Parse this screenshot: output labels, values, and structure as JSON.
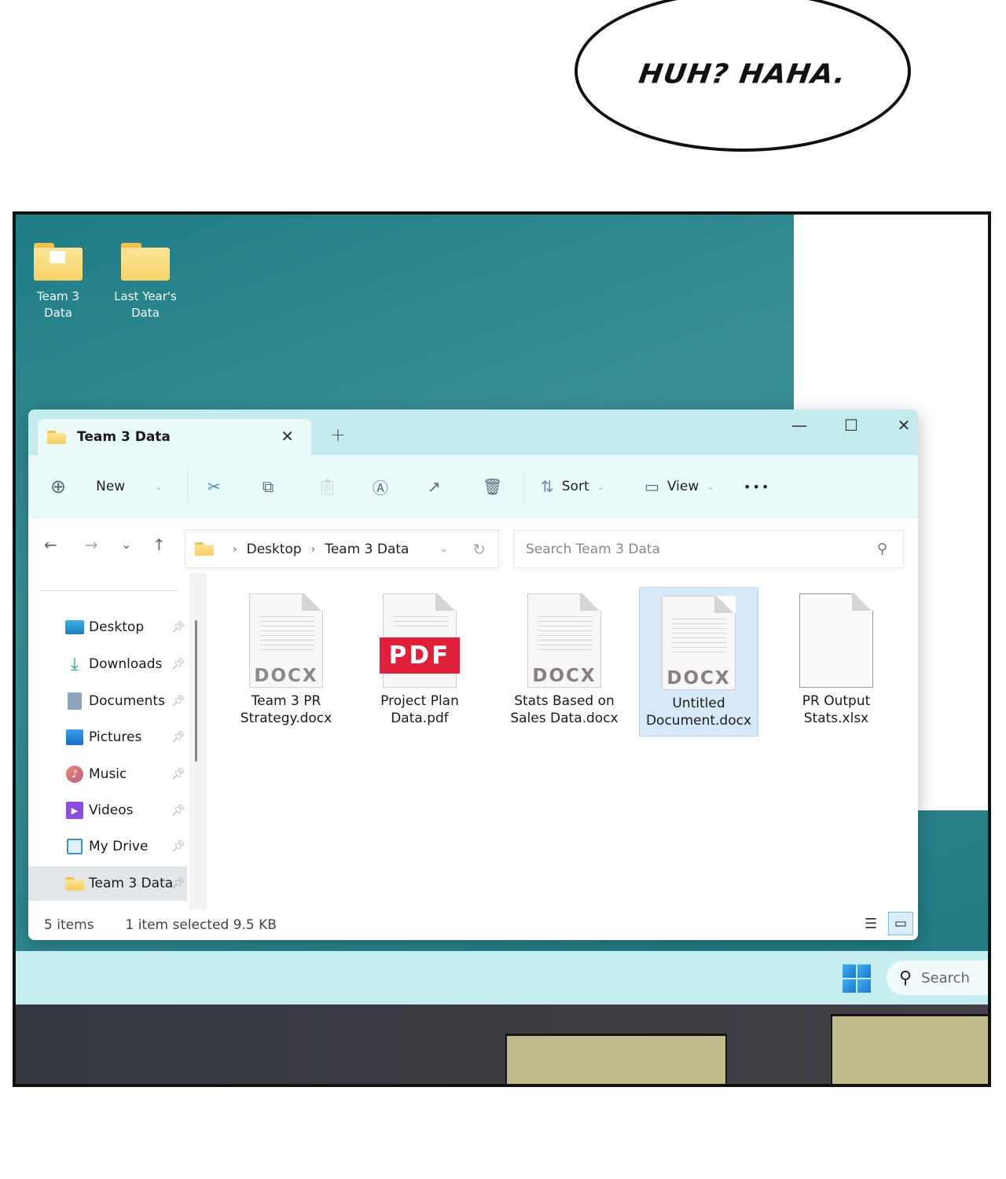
{
  "speech_bubble": {
    "text": "HUH? HAHA."
  },
  "desktop": {
    "icons": [
      {
        "label_line1": "Team 3",
        "label_line2": "Data",
        "icon": "folder-with-file-icon"
      },
      {
        "label_line1": "Last Year's",
        "label_line2": "Data",
        "icon": "folder-icon"
      }
    ]
  },
  "explorer": {
    "tab": {
      "title": "Team 3 Data",
      "close": "✕",
      "add": "+"
    },
    "window_controls": {
      "minimize": "—",
      "maximize": "☐",
      "close": "✕"
    },
    "toolbar": {
      "new_label": "New",
      "sort_label": "Sort",
      "view_label": "View",
      "more": "•••",
      "icons": [
        "add-circle-icon",
        "cut-icon",
        "copy-icon",
        "paste-icon",
        "rename-icon",
        "share-icon",
        "delete-icon",
        "sort-icon",
        "view-icon"
      ]
    },
    "nav": {
      "back": "←",
      "forward": "→",
      "recent": "⌄",
      "up": "↑",
      "breadcrumb": [
        "Desktop",
        "Team 3 Data"
      ],
      "search_placeholder": "Search Team 3 Data"
    },
    "sidebar": {
      "items": [
        {
          "label": "Desktop",
          "icon": "desktop-icon",
          "pinned": true,
          "selected": false
        },
        {
          "label": "Downloads",
          "icon": "download-icon",
          "pinned": true,
          "selected": false
        },
        {
          "label": "Documents",
          "icon": "documents-icon",
          "pinned": true,
          "selected": false
        },
        {
          "label": "Pictures",
          "icon": "pictures-icon",
          "pinned": true,
          "selected": false
        },
        {
          "label": "Music",
          "icon": "music-icon",
          "pinned": true,
          "selected": false
        },
        {
          "label": "Videos",
          "icon": "videos-icon",
          "pinned": true,
          "selected": false
        },
        {
          "label": "My Drive",
          "icon": "drive-icon",
          "pinned": true,
          "selected": false
        },
        {
          "label": "Team 3 Data",
          "icon": "folder-icon",
          "pinned": true,
          "selected": true
        }
      ]
    },
    "files": [
      {
        "name_line1": "Team 3 PR",
        "name_line2": "Strategy.docx",
        "type_label": "DOCX",
        "selected": false
      },
      {
        "name_line1": "Project Plan",
        "name_line2": "Data.pdf",
        "type_label": "PDF",
        "selected": false
      },
      {
        "name_line1": "Stats Based on",
        "name_line2": "Sales Data.docx",
        "type_label": "DOCX",
        "selected": false
      },
      {
        "name_line1": "Untitled",
        "name_line2": "Document.docx",
        "type_label": "DOCX",
        "selected": true
      },
      {
        "name_line1": "PR Output",
        "name_line2": "Stats.xlsx",
        "type_label": "",
        "selected": false
      }
    ],
    "status": {
      "item_count": "5 items",
      "selection": "1 item selected 9.5 KB"
    }
  },
  "taskbar": {
    "search_label": "Search"
  },
  "colors": {
    "desktop": "#2d858d",
    "titlebar": "#c4ecee",
    "selection": "#d7e9f8",
    "pdf_red": "#e0203a",
    "folder_yellow": "#f8d26a"
  }
}
